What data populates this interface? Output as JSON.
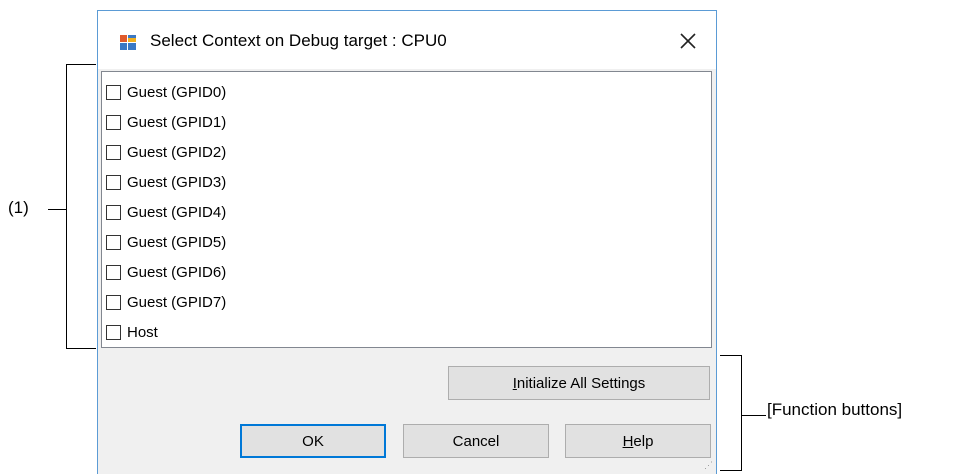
{
  "dialog": {
    "title": "Select Context on Debug target : CPU0",
    "close_icon": "close-icon",
    "title_icon": "window-app-icon"
  },
  "contexts": [
    {
      "label": "Guest (GPID0)",
      "checked": false
    },
    {
      "label": "Guest (GPID1)",
      "checked": false
    },
    {
      "label": "Guest (GPID2)",
      "checked": false
    },
    {
      "label": "Guest (GPID3)",
      "checked": false
    },
    {
      "label": "Guest (GPID4)",
      "checked": false
    },
    {
      "label": "Guest (GPID5)",
      "checked": false
    },
    {
      "label": "Guest (GPID6)",
      "checked": false
    },
    {
      "label": "Guest (GPID7)",
      "checked": false
    },
    {
      "label": "Host",
      "checked": false
    }
  ],
  "buttons": {
    "initialize_mnemonic": "I",
    "initialize_rest": "nitialize All Settings",
    "ok": "OK",
    "cancel": "Cancel",
    "help_mnemonic": "H",
    "help_rest": "elp"
  },
  "annotations": {
    "list_marker": "(1)",
    "function_buttons": "[Function buttons]"
  },
  "colors": {
    "window_border": "#5b9bd5",
    "default_button_border": "#0078d7",
    "dialog_bg": "#f0f0f0"
  }
}
